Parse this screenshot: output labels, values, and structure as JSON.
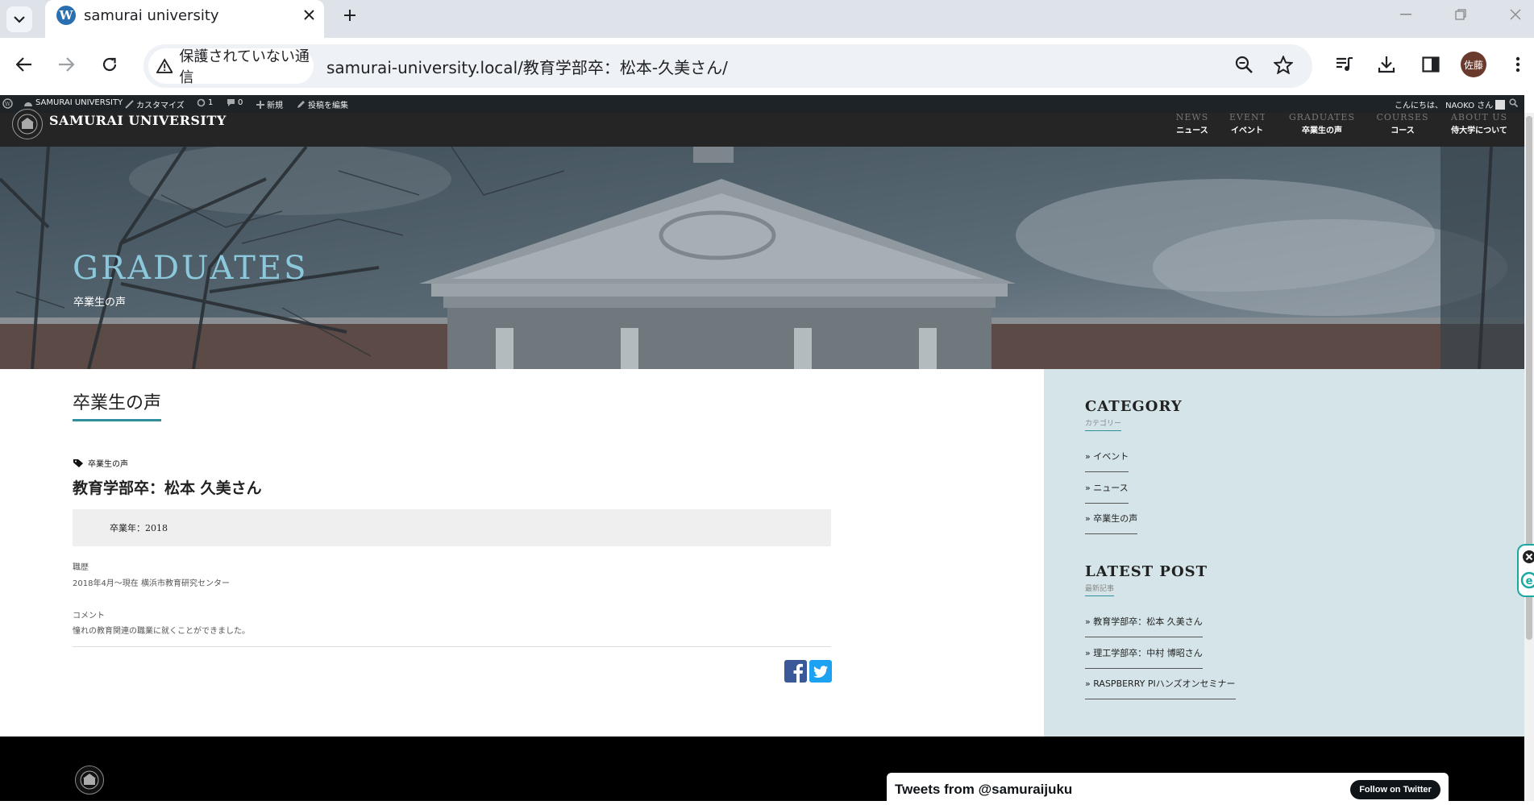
{
  "browser": {
    "tab_title": "samurai university",
    "security_label": "保護されていない通信",
    "url": "samurai-university.local/教育学部卒：松本-久美さん/",
    "profile_initials": "佐藤"
  },
  "admin_bar": {
    "site_name": "SAMURAI UNIVERSITY",
    "customize": "カスタマイズ",
    "updates_count": "1",
    "comments_count": "0",
    "new": "新規",
    "edit_post": "投稿を編集",
    "greeting": "こんにちは、 NAOKO さん"
  },
  "header": {
    "site_title": "SAMURAI UNIVERSITY",
    "nav": [
      {
        "en": "NEWS",
        "ja": "ニュース"
      },
      {
        "en": "EVENT",
        "ja": "イベント"
      },
      {
        "en": "GRADUATES",
        "ja": "卒業生の声"
      },
      {
        "en": "COURSES",
        "ja": "コース"
      },
      {
        "en": "ABOUT US",
        "ja": "侍大学について"
      }
    ]
  },
  "hero": {
    "heading": "GRADUATES",
    "subheading": "卒業生の声"
  },
  "main": {
    "category_title": "卒業生の声",
    "tag": "卒業生の声",
    "post_title": "教育学部卒：松本 久美さん",
    "graduation_year": "卒業年：2018",
    "career_label": "職歴",
    "career_value": "2018年4月〜現在 横浜市教育研究センター",
    "comment_label": "コメント",
    "comment_value": "憧れの教育関連の職業に就くことができました。"
  },
  "sidebar": {
    "category_title": "CATEGORY",
    "category_sub": "カテゴリー",
    "categories": [
      "» イベント",
      "» ニュース",
      "» 卒業生の声"
    ],
    "latest_title": "LATEST POST",
    "latest_sub": "最新記事",
    "latest_posts": [
      "» 教育学部卒：松本 久美さん",
      "» 理工学部卒：中村 博昭さん",
      "» RASPBERRY PIハンズオンセミナー"
    ]
  },
  "footer": {
    "tweets_title": "Tweets from @samuraijuku",
    "follow_label": "Follow on Twitter"
  },
  "colors": {
    "accent": "#2f8f9d",
    "hero_heading": "#8cc8dc",
    "sidebar_bg": "#d4e4e8",
    "facebook": "#3b5998",
    "twitter": "#1da1f2"
  }
}
